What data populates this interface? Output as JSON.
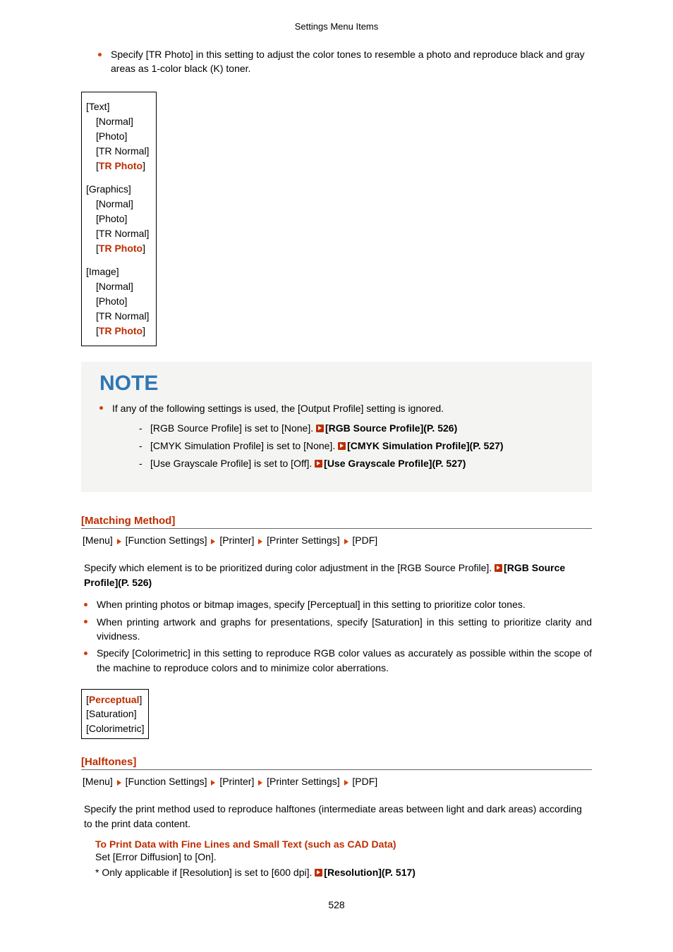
{
  "header": {
    "title": "Settings Menu Items"
  },
  "intro_bullet": "Specify [TR Photo] in this setting to adjust the color tones to resemble a photo and reproduce black and gray areas as 1-color black (K) toner.",
  "option_groups": [
    {
      "title": "[Text]",
      "items": [
        "[Normal]",
        "[Photo]",
        "[TR Normal]"
      ],
      "selected": {
        "open": "[",
        "val": "TR Photo",
        "close": "]"
      }
    },
    {
      "title": "[Graphics]",
      "items": [
        "[Normal]",
        "[Photo]",
        "[TR Normal]"
      ],
      "selected": {
        "open": "[",
        "val": "TR Photo",
        "close": "]"
      }
    },
    {
      "title": "[Image]",
      "items": [
        "[Normal]",
        "[Photo]",
        "[TR Normal]"
      ],
      "selected": {
        "open": "[",
        "val": "TR Photo",
        "close": "]"
      }
    }
  ],
  "note": {
    "title": "NOTE",
    "lead": "If any of the following settings is used, the [Output Profile] setting is ignored.",
    "items": [
      {
        "text": "[RGB Source Profile] is set to [None]. ",
        "link": "[RGB Source Profile](P. 526)"
      },
      {
        "text": "[CMYK Simulation Profile] is set to [None]. ",
        "link": "[CMYK Simulation Profile](P. 527)"
      },
      {
        "text": "[Use Grayscale Profile] is set to [Off]. ",
        "link": "[Use Grayscale Profile](P. 527)"
      }
    ]
  },
  "breadcrumb": {
    "items": [
      "[Menu]",
      "[Function Settings]",
      "[Printer]",
      "[Printer Settings]",
      "[PDF]"
    ]
  },
  "matching": {
    "heading": "[Matching Method]",
    "desc_pre": "Specify which element is to be prioritized during color adjustment in the [RGB Source Profile]. ",
    "desc_link": "[RGB Source Profile](P. 526)",
    "bullets": [
      "When printing photos or bitmap images, specify [Perceptual] in this setting to prioritize color tones.",
      "When printing artwork and graphs for presentations, specify [Saturation] in this setting to prioritize clarity and vividness.",
      "Specify [Colorimetric] in this setting to reproduce RGB color values as accurately as possible within the scope of the machine to reproduce colors and to minimize color aberrations."
    ],
    "options": {
      "selected": {
        "open": "[",
        "val": "Perceptual",
        "close": "]"
      },
      "rest": [
        "[Saturation]",
        "[Colorimetric]"
      ]
    }
  },
  "halftones": {
    "heading": "[Halftones]",
    "desc": "Specify the print method used to reproduce halftones (intermediate areas between light and dark areas) according to the print data content.",
    "sub_title": "To Print Data with Fine Lines and Small Text (such as CAD Data)",
    "sub_text": "Set [Error Diffusion] to [On].",
    "note_pre": "* Only applicable if [Resolution] is set to [600 dpi]. ",
    "note_link": "[Resolution](P. 517)"
  },
  "page_number": "528"
}
